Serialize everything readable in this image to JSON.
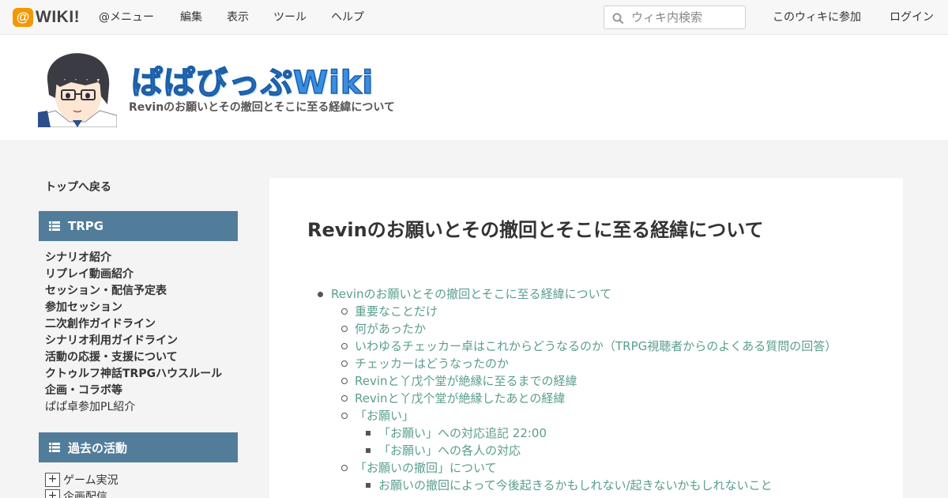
{
  "topbar": {
    "logo_mark": "@",
    "logo_text": "WIKI!",
    "menu": [
      "@メニュー",
      "編集",
      "表示",
      "ツール",
      "ヘルプ"
    ],
    "search_placeholder": "ウィキ内検索",
    "join": "このウィキに参加",
    "login": "ログイン"
  },
  "header": {
    "site_title": "ぱぱびっぷWiki",
    "subtitle": "Revinのお願いとその撤回とそこに至る経緯について"
  },
  "sidebar": {
    "back": "トップへ戻る",
    "section1": "TRPG",
    "items": [
      "シナリオ紹介",
      "リプレイ動画紹介",
      "セッション・配信予定表",
      "参加セッション",
      "二次創作ガイドライン",
      "シナリオ利用ガイドライン",
      "活動の応援・支援について",
      "クトゥルフ神話TRPGハウスルール",
      "企画・コラボ等",
      "ぱぱ卓参加PL紹介"
    ],
    "section2": "過去の活動",
    "toggles": [
      "ゲーム実況",
      "企画配信"
    ],
    "toggle_symbol": "+"
  },
  "main": {
    "title": "Revinのお願いとその撤回とそこに至る経緯について",
    "toc": [
      "Revinのお願いとその撤回とそこに至る経緯について",
      "重要なことだけ",
      "何があったか",
      "いわゆるチェッカー卓はこれからどうなるのか（TRPG視聴者からのよくある質問の回答）",
      "チェッカーはどうなったのか",
      "Revinと丫戊个堂が絶縁に至るまでの経緯",
      "Revinと丫戊个堂が絶縁したあとの経緯",
      "「お願い」",
      "「お願い」への対応追記 22:00",
      "「お願い」への各人の対応",
      "「お願いの撤回」について",
      "お願いの撤回によって今後起きるかもしれない/起きないかもしれないこと"
    ]
  },
  "colors": {
    "accent": "#f39800",
    "sidebar_head": "#517d9b",
    "link": "#5a9e8e",
    "title_blue": "#3a8ee0"
  }
}
